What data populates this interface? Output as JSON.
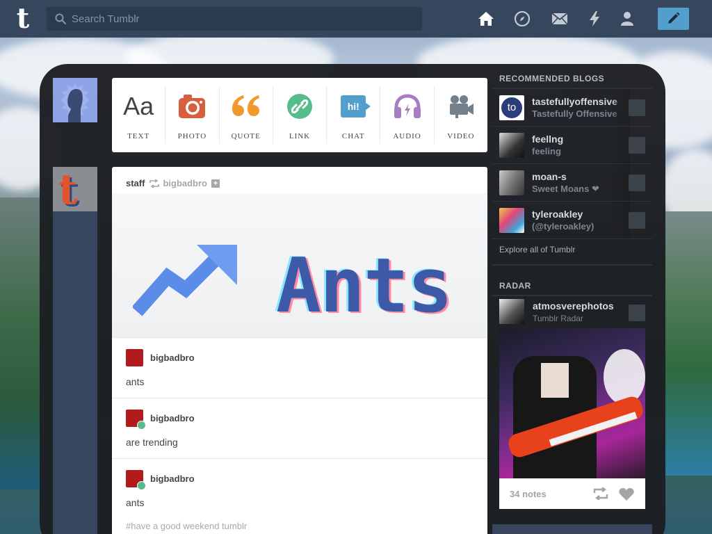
{
  "search": {
    "placeholder": "Search Tumblr"
  },
  "post_types": [
    {
      "label": "TEXT",
      "icon": "text-icon",
      "glyph": "Aa",
      "color": "#444444"
    },
    {
      "label": "PHOTO",
      "icon": "camera-icon",
      "color": "#d95e40"
    },
    {
      "label": "QUOTE",
      "icon": "quote-icon",
      "glyph": "❝",
      "color": "#f2992e"
    },
    {
      "label": "LINK",
      "icon": "link-icon",
      "color": "#56bc8a"
    },
    {
      "label": "CHAT",
      "icon": "chat-icon",
      "glyph": "hi!",
      "color": "#529ecc"
    },
    {
      "label": "AUDIO",
      "icon": "headphones-icon",
      "color": "#a77dc2"
    },
    {
      "label": "VIDEO",
      "icon": "video-camera-icon",
      "color": "#748089"
    }
  ],
  "post": {
    "author": "staff",
    "reblogged_from": "bigbadbro",
    "image_text": "Ants",
    "thread": [
      {
        "name": "bigbadbro",
        "text": "ants",
        "reblog_badge": false
      },
      {
        "name": "bigbadbro",
        "text": "are trending",
        "reblog_badge": true
      },
      {
        "name": "bigbadbro",
        "text": "ants",
        "reblog_badge": true
      }
    ],
    "tags": "#have a good weekend tumblr"
  },
  "sidebar": {
    "recommended_title": "RECOMMENDED BLOGS",
    "blogs": [
      {
        "name": "tastefullyoffensive",
        "desc": "Tastefully Offensive",
        "avatar_color": "#ffffff"
      },
      {
        "name": "feellng",
        "desc": "feeling",
        "avatar_color": "#5a5a5a"
      },
      {
        "name": "moan-s",
        "desc": "Sweet Moans ❤",
        "avatar_color": "#7a7a7a"
      },
      {
        "name": "tyleroakley",
        "desc": "(@tyleroakley)",
        "avatar_color": "#c2477a"
      }
    ],
    "explore": "Explore all of Tumblr",
    "radar_title": "RADAR",
    "radar": {
      "name": "atmosverephotos",
      "desc": "Tumblr Radar",
      "notes": "34 notes"
    }
  }
}
